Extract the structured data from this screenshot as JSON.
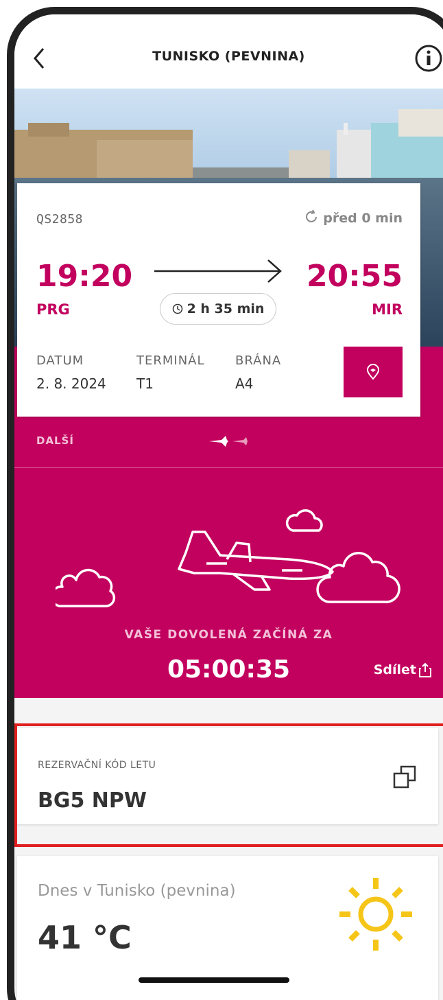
{
  "header": {
    "title": "TUNISKO (PEVNINA)"
  },
  "flight": {
    "number": "QS2858",
    "updated": "před 0 min",
    "departure_time": "19:20",
    "departure_code": "PRG",
    "arrival_time": "20:55",
    "arrival_code": "MIR",
    "duration": "2 h 35 min",
    "date_label": "DATUM",
    "date_value": "2. 8. 2024",
    "terminal_label": "TERMINÁL",
    "terminal_value": "T1",
    "gate_label": "BRÁNA",
    "gate_value": "A4"
  },
  "next": {
    "label": "DALŠÍ"
  },
  "countdown": {
    "label": "VAŠE DOVOLENÁ ZAČÍNÁ ZA",
    "value": "05:00:35",
    "share_label": "Sdílet"
  },
  "booking": {
    "label": "REZERVAČNÍ KÓD LETU",
    "code": "BG5 NPW"
  },
  "weather": {
    "title": "Dnes v Tunisko (pevnina)",
    "temperature": "41 °C",
    "condition_icon": "sun-icon"
  },
  "colors": {
    "brand": "#c2005e",
    "highlight": "#e02020",
    "sun": "#f5c518"
  }
}
